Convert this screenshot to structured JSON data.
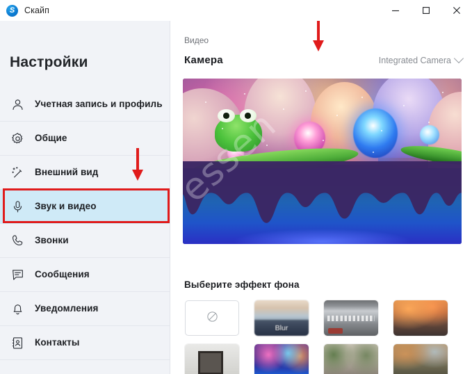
{
  "window": {
    "app_name": "Скайп",
    "logo_letter": "S",
    "controls": [
      {
        "name": "minimize",
        "label": "—"
      },
      {
        "name": "maximize",
        "label": "▢"
      },
      {
        "name": "close",
        "label": "✕"
      }
    ]
  },
  "sidebar": {
    "title": "Настройки",
    "items": [
      {
        "label": "Учетная запись и профиль",
        "icon": "person-icon",
        "selected": false
      },
      {
        "label": "Общие",
        "icon": "gear-icon",
        "selected": false
      },
      {
        "label": "Внешний вид",
        "icon": "magic-wand-icon",
        "selected": false
      },
      {
        "label": "Звук и видео",
        "icon": "microphone-icon",
        "selected": true
      },
      {
        "label": "Звонки",
        "icon": "phone-icon",
        "selected": false
      },
      {
        "label": "Сообщения",
        "icon": "chat-icon",
        "selected": false
      },
      {
        "label": "Уведомления",
        "icon": "bell-icon",
        "selected": false
      },
      {
        "label": "Контакты",
        "icon": "contacts-icon",
        "selected": false
      }
    ]
  },
  "main": {
    "section_kicker": "Видео",
    "camera_label": "Камера",
    "camera_value": "Integrated Camera",
    "background_title": "Выберите эффект фона",
    "video_watermark": "essen",
    "backgrounds": [
      {
        "name": "none",
        "label": "",
        "style": "none"
      },
      {
        "name": "blur",
        "label": "Blur",
        "style": "t-blur"
      },
      {
        "name": "office",
        "label": "",
        "style": "t-office"
      },
      {
        "name": "autumn-street",
        "label": "",
        "style": "t-autumn"
      },
      {
        "name": "room-mirror",
        "label": "",
        "style": "t-room"
      },
      {
        "name": "neon-candy",
        "label": "",
        "style": "t-neon"
      },
      {
        "name": "christmas-tree",
        "label": "",
        "style": "t-xmas"
      },
      {
        "name": "garden-wall",
        "label": "",
        "style": "t-garden"
      }
    ]
  },
  "colors": {
    "accent": "#0078d4",
    "annotation_red": "#e01b1b",
    "selected_row": "#cfeaf7",
    "sidebar_bg": "#f1f3f7"
  }
}
